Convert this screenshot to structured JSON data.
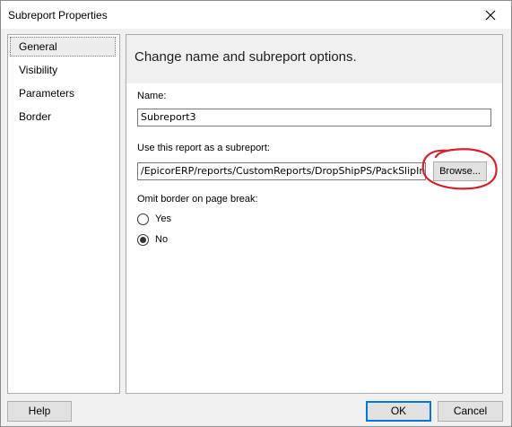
{
  "window": {
    "title": "Subreport Properties",
    "close_icon": "close-icon"
  },
  "nav": {
    "items": [
      {
        "label": "General",
        "selected": true
      },
      {
        "label": "Visibility",
        "selected": false
      },
      {
        "label": "Parameters",
        "selected": false
      },
      {
        "label": "Border",
        "selected": false
      }
    ]
  },
  "content": {
    "heading": "Change name and subreport options.",
    "name_label": "Name:",
    "name_value": "Subreport3",
    "subreport_label": "Use this report as a subreport:",
    "subreport_value": "/EpicorERP/reports/CustomReports/DropShipPS/PackSlipInvoi",
    "browse_label": "Browse...",
    "omit_border_label": "Omit border on page break:",
    "radio_options": [
      {
        "label": "Yes",
        "checked": false
      },
      {
        "label": "No",
        "checked": true
      }
    ]
  },
  "footer": {
    "help_label": "Help",
    "ok_label": "OK",
    "cancel_label": "Cancel"
  },
  "colors": {
    "annotation": "#d4202a",
    "ok_border": "#0078d7",
    "header_bg": "#f0f0f0"
  }
}
